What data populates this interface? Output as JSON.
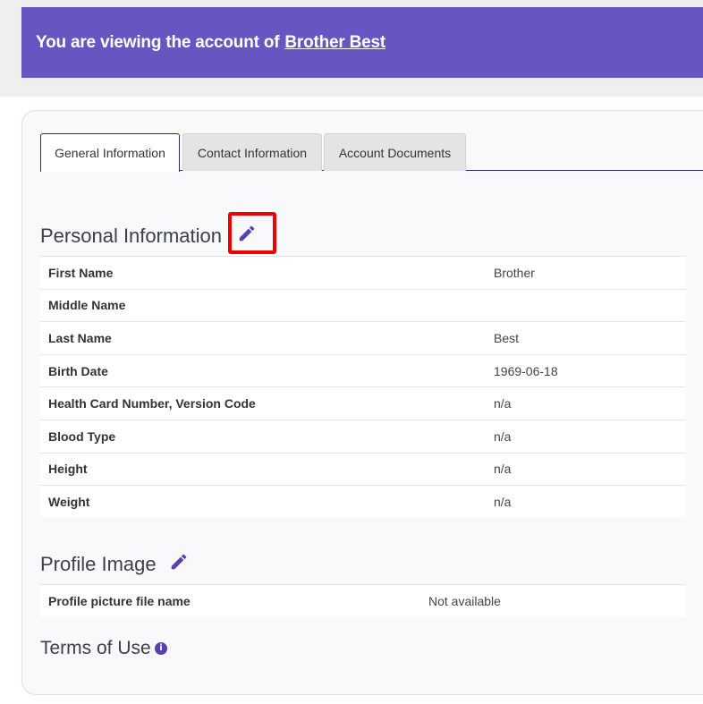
{
  "banner": {
    "prefix": "You are viewing the account of",
    "user_name": "Brother Best"
  },
  "tabs": [
    {
      "label": "General Information",
      "active": true
    },
    {
      "label": "Contact Information",
      "active": false
    },
    {
      "label": "Account Documents",
      "active": false
    }
  ],
  "personal_information": {
    "title": "Personal Information",
    "edit_icon": "pencil-icon",
    "rows": [
      {
        "label": "First Name",
        "value": "Brother"
      },
      {
        "label": "Middle Name",
        "value": ""
      },
      {
        "label": "Last Name",
        "value": "Best"
      },
      {
        "label": "Birth Date",
        "value": "1969-06-18"
      },
      {
        "label": "Health Card Number, Version Code",
        "value": "n/a"
      },
      {
        "label": "Blood Type",
        "value": "n/a"
      },
      {
        "label": "Height",
        "value": "n/a"
      },
      {
        "label": "Weight",
        "value": "n/a"
      }
    ]
  },
  "profile_image": {
    "title": "Profile Image",
    "edit_icon": "pencil-icon",
    "rows": [
      {
        "label": "Profile picture file name",
        "value": "Not available"
      }
    ]
  },
  "terms_of_use": {
    "title": "Terms of Use",
    "icon": "info-icon",
    "icon_glyph": "i"
  },
  "colors": {
    "accent": "#6755c2",
    "icon": "#5a3fb0",
    "highlight": "#ee0000"
  }
}
